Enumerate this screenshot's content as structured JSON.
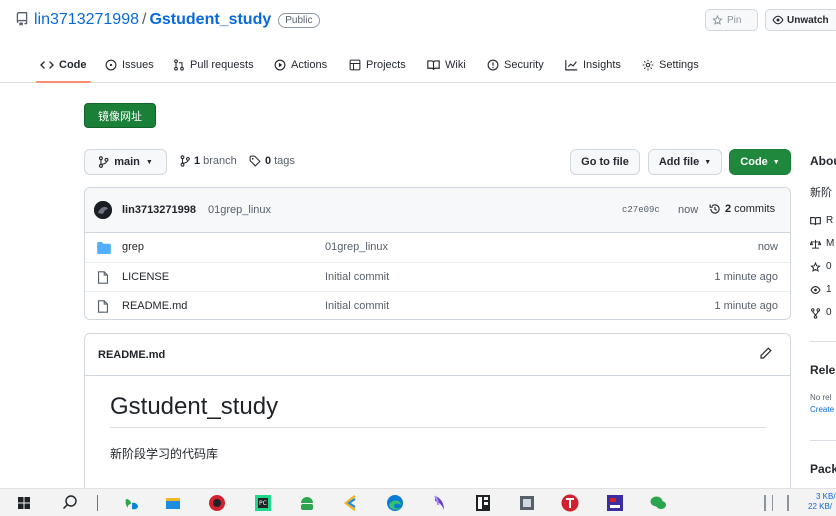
{
  "repo": {
    "owner": "lin3713271998",
    "separator": "/",
    "name": "Gstudent_study",
    "visibility": "Public"
  },
  "header_buttons": {
    "pin": "Pin",
    "unwatch": "Unwatch"
  },
  "tabs": [
    {
      "label": "Code",
      "icon": "code-icon",
      "active": true
    },
    {
      "label": "Issues",
      "icon": "issue-icon"
    },
    {
      "label": "Pull requests",
      "icon": "pull-request-icon"
    },
    {
      "label": "Actions",
      "icon": "play-icon"
    },
    {
      "label": "Projects",
      "icon": "table-icon"
    },
    {
      "label": "Wiki",
      "icon": "book-icon"
    },
    {
      "label": "Security",
      "icon": "shield-icon"
    },
    {
      "label": "Insights",
      "icon": "graph-icon"
    },
    {
      "label": "Settings",
      "icon": "gear-icon"
    }
  ],
  "mirror_button": "镜像网址",
  "branch_selector": "main",
  "branch_count": "1",
  "branch_label": "branch",
  "tag_count": "0",
  "tag_label": "tags",
  "actions": {
    "go_to_file": "Go to file",
    "add_file": "Add file",
    "code": "Code"
  },
  "latest_commit": {
    "author": "lin3713271998",
    "message": "01grep_linux",
    "hash": "c27e09c",
    "time": "now",
    "commit_count": "2",
    "commit_label": "commits"
  },
  "files": [
    {
      "name": "grep",
      "type": "folder",
      "message": "01grep_linux",
      "time": "now"
    },
    {
      "name": "LICENSE",
      "type": "file",
      "message": "Initial commit",
      "time": "1 minute ago"
    },
    {
      "name": "README.md",
      "type": "file",
      "message": "Initial commit",
      "time": "1 minute ago"
    }
  ],
  "readme": {
    "filename": "README.md",
    "heading": "Gstudent_study",
    "body": "新阶段学习的代码库"
  },
  "sidebar": {
    "about": "Abou",
    "desc": "新阶",
    "items": [
      "R",
      "M",
      "0",
      "1",
      "0"
    ],
    "releases": "Rele",
    "no_releases": "No rel",
    "create": "Create",
    "packages": "Pack"
  },
  "taskbar": {
    "tray_lines": [
      "3 KB/",
      "22 KB/"
    ]
  },
  "colors": {
    "accent": "#0969da",
    "green": "#1f883d",
    "tab_underline": "#fd8c73"
  }
}
